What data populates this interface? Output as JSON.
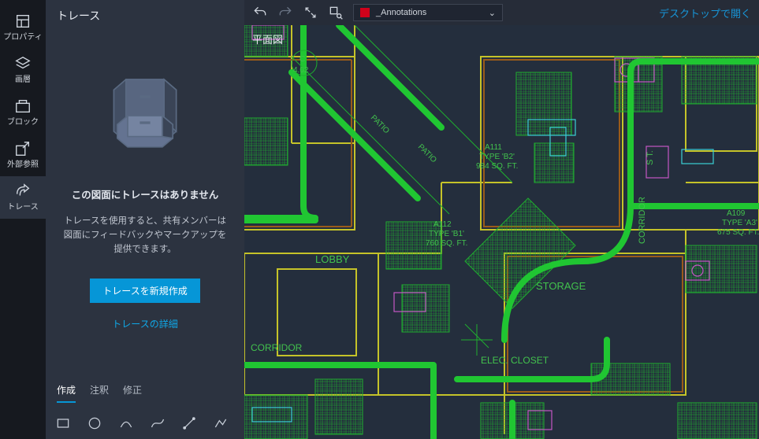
{
  "leftnav": {
    "items": [
      {
        "label": "プロパティ"
      },
      {
        "label": "画層"
      },
      {
        "label": "ブロック"
      },
      {
        "label": "外部参照"
      },
      {
        "label": "トレース"
      }
    ]
  },
  "panel": {
    "title": "トレース",
    "heading": "この図面にトレースはありません",
    "desc": "トレースを使用すると、共有メンバーは図面にフィードバックやマークアップを提供できます。",
    "create_btn": "トレースを新規作成",
    "details_link": "トレースの詳細"
  },
  "bottom_tabs": {
    "t0": "作成",
    "t1": "注釈",
    "t2": "修正"
  },
  "topbar": {
    "layer_name": "_Annotations",
    "open_desktop": "デスクトップで開く"
  },
  "viewport": {
    "name": "平面図"
  },
  "plan_labels": {
    "c": "C",
    "c_area": "4.02",
    "patio": "PATIO",
    "a111": "A111",
    "a111_t": "TYPE 'B2'",
    "a111_a": "984 SQ. FT.",
    "a112": "A112",
    "a112_t": "TYPE 'B1'",
    "a112_a": "760 SQ. FT.",
    "a109": "A109",
    "a109_t": "TYPE 'A3'",
    "a109_a": "675 SQ. FT.",
    "lobby": "LOBBY",
    "storage": "STORAGE",
    "corridor": "CORRIDOR",
    "elec": "ELEC. CLOSET",
    "st": "S T."
  }
}
